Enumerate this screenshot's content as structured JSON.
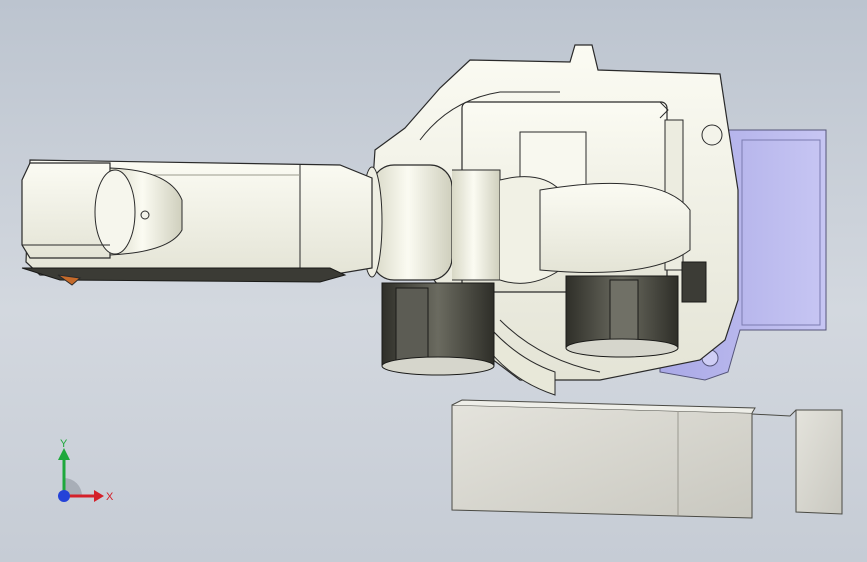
{
  "viewport": {
    "background_top": "#bcc4cf",
    "background_bottom": "#c6ccd5"
  },
  "model": {
    "part_fill": "#f4f4ea",
    "part_stroke": "#2a2a2a",
    "base_plate_color": "#b9b8ee",
    "motor_color": "#4f4f47",
    "lower_box_color": "#d9d8d0"
  },
  "triad": {
    "x_label": "X",
    "y_label": "Y",
    "x_color": "#d4202a",
    "y_color": "#1ea83c",
    "z_color": "#2442d8"
  }
}
